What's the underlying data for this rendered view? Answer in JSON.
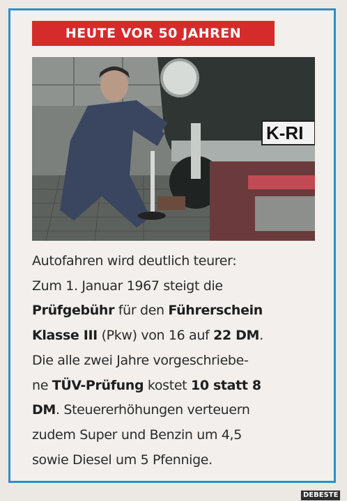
{
  "banner": {
    "title": "HEUTE VOR 50 JAHREN"
  },
  "photo": {
    "plate_text": "K-RI"
  },
  "article": {
    "lines": [
      [
        {
          "t": "Autofahren wird deutlich teurer:"
        }
      ],
      [
        {
          "t": "Zum 1. Januar 1967 steigt die"
        }
      ],
      [
        {
          "t": "Prüfgebühr",
          "b": true
        },
        {
          "t": " für den "
        },
        {
          "t": "Führerschein",
          "b": true
        }
      ],
      [
        {
          "t": "Klasse III",
          "b": true
        },
        {
          "t": " (Pkw) von 16 auf "
        },
        {
          "t": "22 DM",
          "b": true
        },
        {
          "t": "."
        }
      ],
      [
        {
          "t": "Die alle zwei Jahre vorgeschriebe-"
        }
      ],
      [
        {
          "t": "ne "
        },
        {
          "t": "TÜV-Prüfung",
          "b": true
        },
        {
          "t": " kostet "
        },
        {
          "t": "10 statt 8",
          "b": true
        }
      ],
      [
        {
          "t": "DM",
          "b": true
        },
        {
          "t": ". Steuererhöhungen verteuern"
        }
      ],
      [
        {
          "t": "zudem Super und Benzin um 4,5"
        }
      ],
      [
        {
          "t": "sowie Diesel um 5 Pfennige."
        }
      ]
    ]
  },
  "watermark": {
    "text": "DEBESTE"
  }
}
